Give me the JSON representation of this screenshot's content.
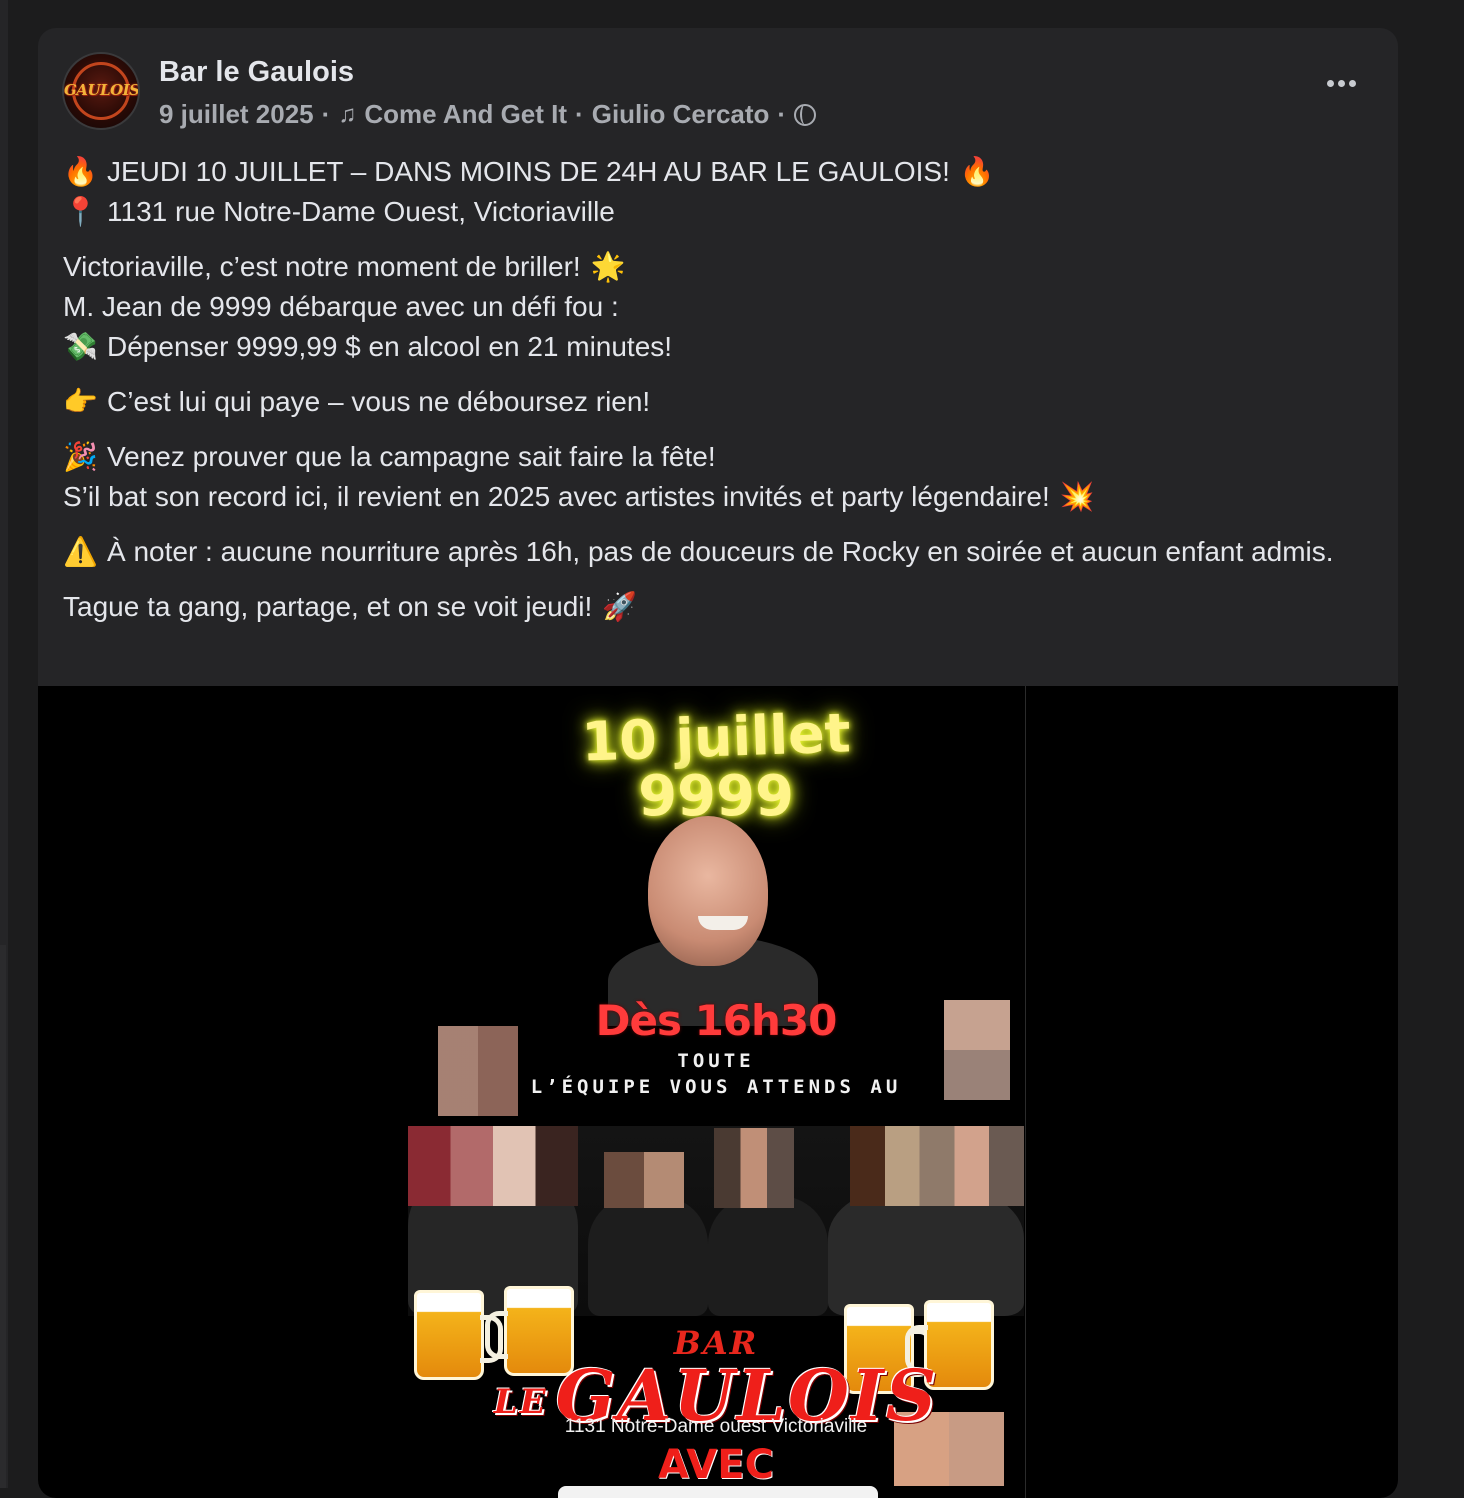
{
  "post": {
    "page_name": "Bar le Gaulois",
    "avatar_logo": "GAULOIS",
    "date": "9 juillet 2025",
    "song": "Come And Get It",
    "artist": "Giulio Cercato",
    "separator": "·",
    "icons": {
      "music": "music-note-icon",
      "privacy": "globe-icon",
      "more": "more-options-icon"
    }
  },
  "body": {
    "line1": "JEUDI 10 JUILLET – DANS MOINS DE 24H AU BAR LE GAULOIS!",
    "line2": "1131 rue Notre-Dame Ouest, Victoriaville",
    "line3": "Victoriaville, c’est notre moment de briller!",
    "line4": "M. Jean de 9999 débarque avec un défi fou :",
    "line5": "Dépenser 9999,99 $ en alcool en 21 minutes!",
    "line6": "C’est lui qui paye – vous ne déboursez rien!",
    "line7": "Venez prouver que la campagne sait faire la fête!",
    "line8": "S’il bat son record ici, il revient en 2025 avec artistes invités et party légendaire!",
    "line9": "À noter : aucune nourriture après 16h, pas de douceurs de Rocky en soirée et aucun enfant admis.",
    "line10": "Tague ta gang, partage, et on se voit jeudi!",
    "emoji": {
      "fire": "🔥",
      "pin": "📍",
      "sparkle": "🌟",
      "money": "💸",
      "point": "👉",
      "party": "🎉",
      "boom": "💥",
      "warning": "⚠️",
      "rocket": "🚀"
    }
  },
  "poster": {
    "date_line": "10 juillet",
    "number": "9999",
    "time": "Dès 16h30",
    "team_line1": "TOUTE",
    "team_line2": "L’ÉQUIPE VOUS ATTENDS AU",
    "bar": "BAR",
    "le": "LE",
    "gaulois": "GAULOIS",
    "address": "1131 Notre-Dame ouest Victoriaville",
    "avec": "AVEC"
  }
}
